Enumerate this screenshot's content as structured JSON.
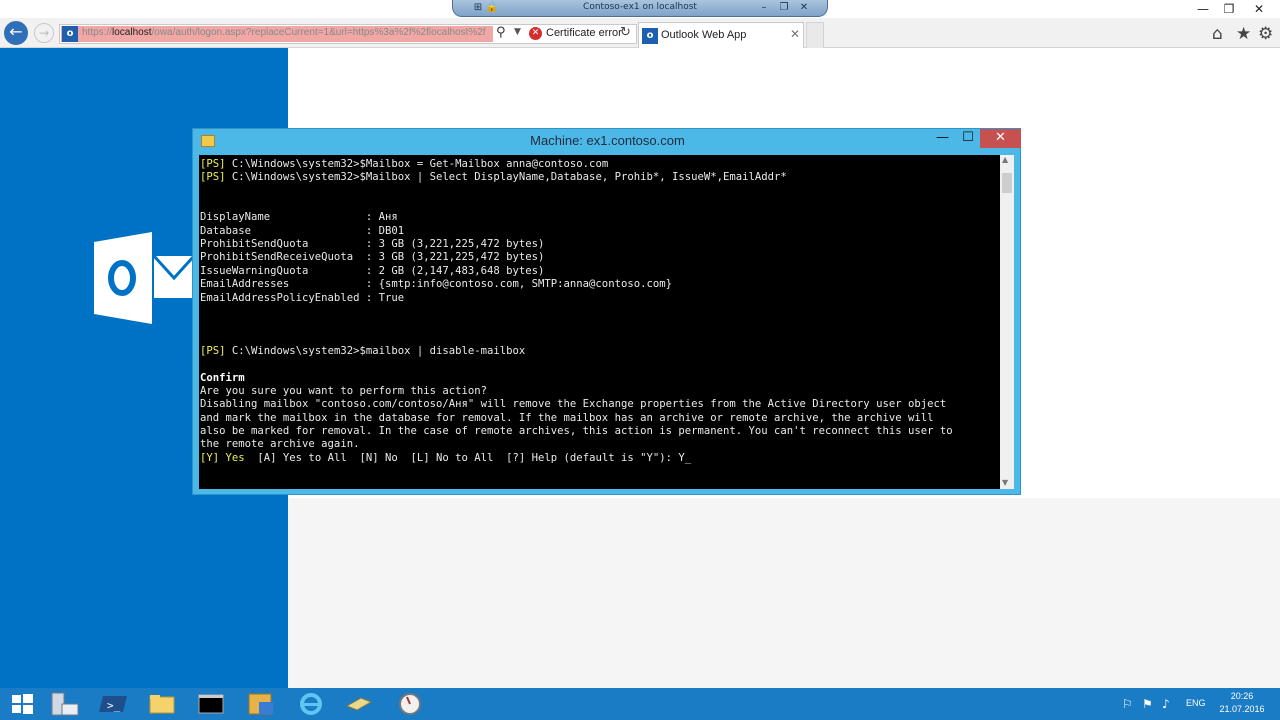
{
  "rdp": {
    "title": "Contoso-ex1 on localhost"
  },
  "browser": {
    "url_prefix": "https://",
    "url_host": "localhost",
    "url_rest": "/owa/auth/logon.aspx?replaceCurrent=1&url=https%3a%2f%2flocalhost%2f",
    "cert_error": "Certificate error",
    "tab_title": "Outlook Web App",
    "favicon_letter": "o"
  },
  "console": {
    "window_title": "Machine: ex1.contoso.com",
    "lines": [
      {
        "prompt": "[PS]",
        "text": " C:\\Windows\\system32>$Mailbox = Get-Mailbox anna@contoso.com"
      },
      {
        "prompt": "[PS]",
        "text": " C:\\Windows\\system32>$Mailbox | Select DisplayName,Database, Prohib*, IssueW*,EmailAddr*"
      },
      {
        "text": ""
      },
      {
        "text": ""
      },
      {
        "text": "DisplayName               : Аня"
      },
      {
        "text": "Database                  : DB01"
      },
      {
        "text": "ProhibitSendQuota         : 3 GB (3,221,225,472 bytes)"
      },
      {
        "text": "ProhibitSendReceiveQuota  : 3 GB (3,221,225,472 bytes)"
      },
      {
        "text": "IssueWarningQuota         : 2 GB (2,147,483,648 bytes)"
      },
      {
        "text": "EmailAddresses            : {smtp:info@contoso.com, SMTP:anna@contoso.com}"
      },
      {
        "text": "EmailAddressPolicyEnabled : True"
      },
      {
        "text": ""
      },
      {
        "text": ""
      },
      {
        "text": ""
      },
      {
        "prompt": "[PS]",
        "text": " C:\\Windows\\system32>$mailbox | disable-mailbox"
      },
      {
        "text": ""
      },
      {
        "text": "Confirm",
        "bold": true
      },
      {
        "text": "Are you sure you want to perform this action?"
      },
      {
        "text": "Disabling mailbox \"contoso.com/contoso/Аня\" will remove the Exchange properties from the Active Directory user object"
      },
      {
        "text": "and mark the mailbox in the database for removal. If the mailbox has an archive or remote archive, the archive will"
      },
      {
        "text": "also be marked for removal. In the case of remote archives, this action is permanent. You can't reconnect this user to"
      },
      {
        "text": "the remote archive again."
      },
      {
        "prompt": "[Y] Yes",
        "text": "  [A] Yes to All  [N] No  [L] No to All  [?] Help (default is \"Y\"): Y_"
      }
    ]
  },
  "taskbar": {
    "language": "ENG",
    "time": "20:26",
    "date": "21.07.2016"
  }
}
